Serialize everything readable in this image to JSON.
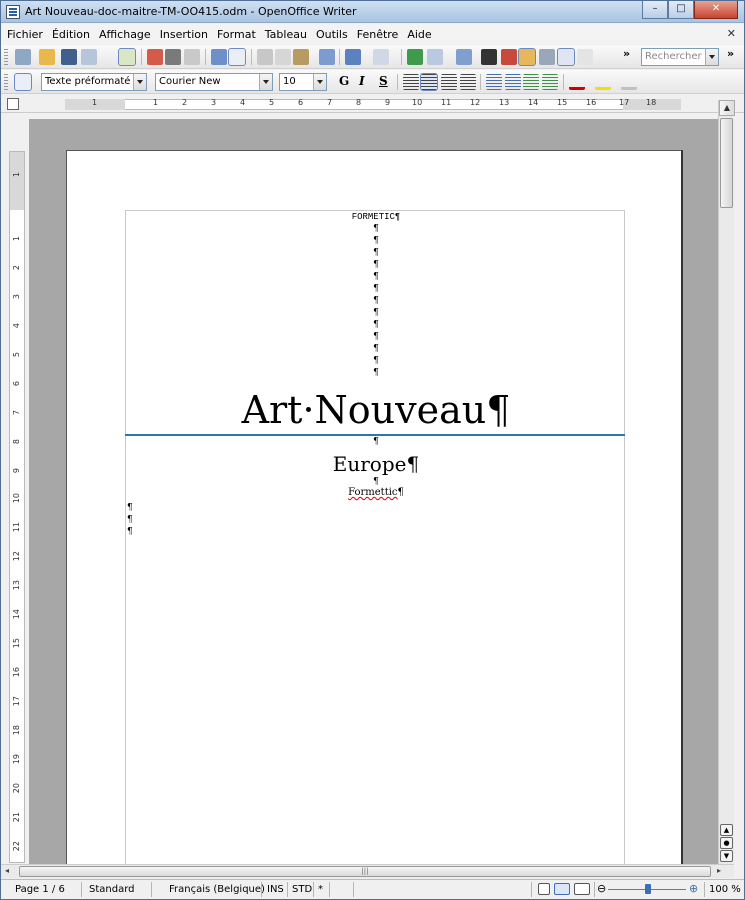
{
  "window": {
    "title": "Art Nouveau-doc-maitre-TM-OO415.odm - OpenOffice Writer",
    "minimize": "–",
    "maximize": "□",
    "close": "✕"
  },
  "menu": {
    "items": [
      {
        "label": "Fichier"
      },
      {
        "label": "Édition"
      },
      {
        "label": "Affichage"
      },
      {
        "label": "Insertion"
      },
      {
        "label": "Format"
      },
      {
        "label": "Tableau"
      },
      {
        "label": "Outils"
      },
      {
        "label": "Fenêtre"
      },
      {
        "label": "Aide"
      }
    ],
    "doc_close": "✕"
  },
  "toolbar": {
    "search_placeholder": "Rechercher",
    "more": "»"
  },
  "format_bar": {
    "paragraph_style": "Texte préformaté",
    "font_name": "Courier New",
    "font_size": "10",
    "bold": "G",
    "italic": "I",
    "underline": "S"
  },
  "ruler": {
    "h_ticks": [
      "1",
      "1",
      "2",
      "3",
      "4",
      "5",
      "6",
      "7",
      "8",
      "9",
      "10",
      "11",
      "12",
      "13",
      "14",
      "15",
      "16",
      "17",
      "18"
    ],
    "v_ticks": [
      "1",
      "1",
      "2",
      "3",
      "4",
      "5",
      "6",
      "7",
      "8",
      "9",
      "10",
      "11",
      "12",
      "13",
      "14",
      "15",
      "16",
      "17",
      "18",
      "19",
      "20",
      "21",
      "22"
    ]
  },
  "document": {
    "header_text": "FORMETIC¶",
    "pilcrow": "¶",
    "title": "Art·Nouveau¶",
    "subtitle": "Europe¶",
    "author_word": "Formettic",
    "author_mark": "¶"
  },
  "status": {
    "page": "Page 1 / 6",
    "style": "Standard",
    "language": "Français (Belgique)",
    "insert_mode": "INS",
    "selection_mode": "STD",
    "modified": "*",
    "zoom_minus": "⊖",
    "zoom_plus": "⊕",
    "zoom": "100 %"
  },
  "colors": {
    "title_rule": "#2e74b5",
    "spell_underline": "#dd0000"
  }
}
